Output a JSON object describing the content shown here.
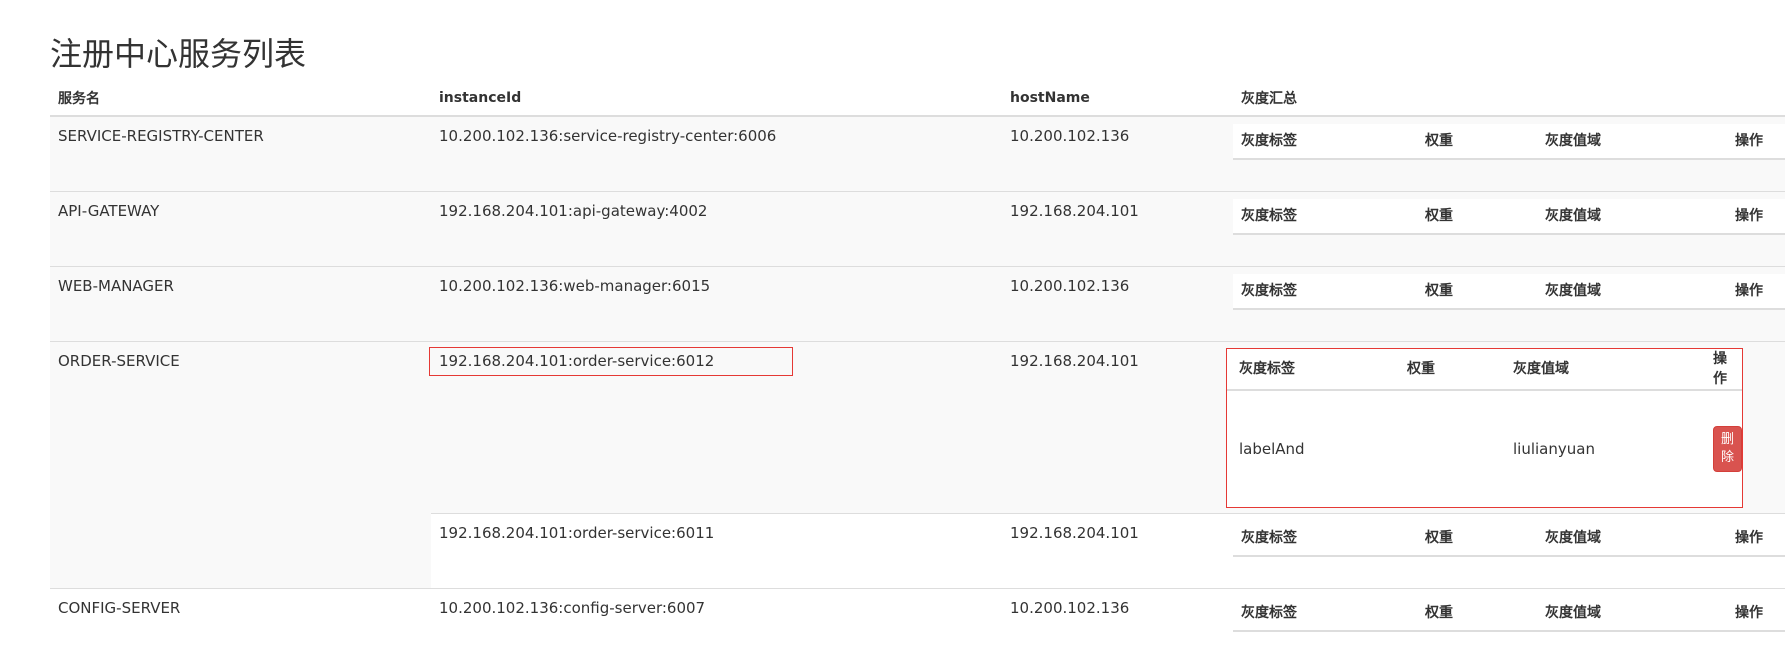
{
  "title": "注册中心服务列表",
  "columns": {
    "service": "服务名",
    "instance": "instanceId",
    "host": "hostName",
    "gray": "灰度汇总"
  },
  "gray_headers": {
    "label": "灰度标签",
    "weight": "权重",
    "domain": "灰度值域",
    "action": "操作"
  },
  "rows": [
    {
      "service": "SERVICE-REGISTRY-CENTER",
      "instance": "10.200.102.136:service-registry-center:6006",
      "host": "10.200.102.136"
    },
    {
      "service": "API-GATEWAY",
      "instance": "192.168.204.101:api-gateway:4002",
      "host": "192.168.204.101"
    },
    {
      "service": "WEB-MANAGER",
      "instance": "10.200.102.136:web-manager:6015",
      "host": "10.200.102.136"
    },
    {
      "service": "ORDER-SERVICE",
      "instance": "192.168.204.101:order-service:6012",
      "host": "192.168.204.101",
      "gray_entry": {
        "label": "labelAnd",
        "weight": "",
        "domain": "liulianyuan",
        "action": "删除"
      }
    },
    {
      "service": "",
      "instance": "192.168.204.101:order-service:6011",
      "host": "192.168.204.101"
    },
    {
      "service": "CONFIG-SERVER",
      "instance": "10.200.102.136:config-server:6007",
      "host": "10.200.102.136"
    }
  ],
  "colors": {
    "highlight": "#e53935",
    "danger": "#d9534f",
    "stripe": "#f9f9f9"
  }
}
